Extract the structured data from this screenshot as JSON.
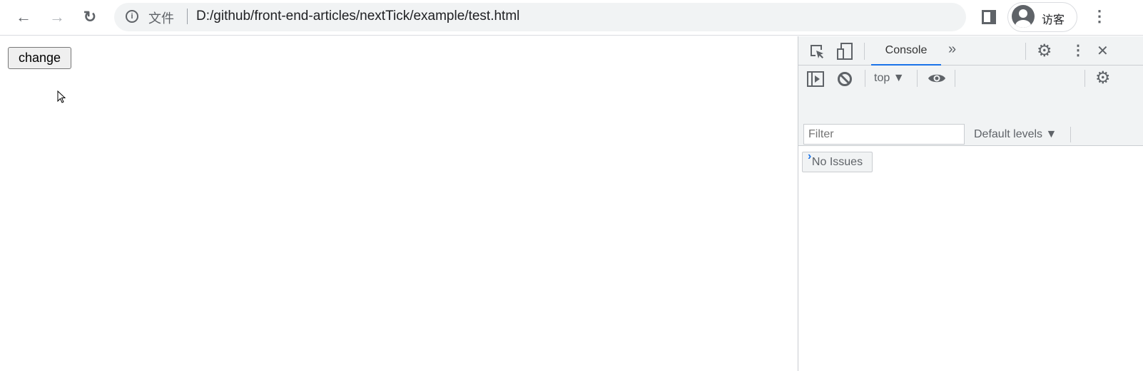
{
  "browser": {
    "back": "←",
    "forward": "→",
    "reload": "↻",
    "info": "i",
    "file_label": "文件",
    "url": "D:/github/front-end-articles/nextTick/example/test.html",
    "profile_name": "访客",
    "menu": "⋮"
  },
  "page": {
    "button_label": "change"
  },
  "devtools": {
    "more_tabs": "»",
    "tab": "Console",
    "menu": "⋮",
    "close": "✕",
    "context": "top ▼",
    "filter_placeholder": "Filter",
    "levels": "Default levels ▼",
    "issues": "No Issues",
    "prompt": "›"
  }
}
